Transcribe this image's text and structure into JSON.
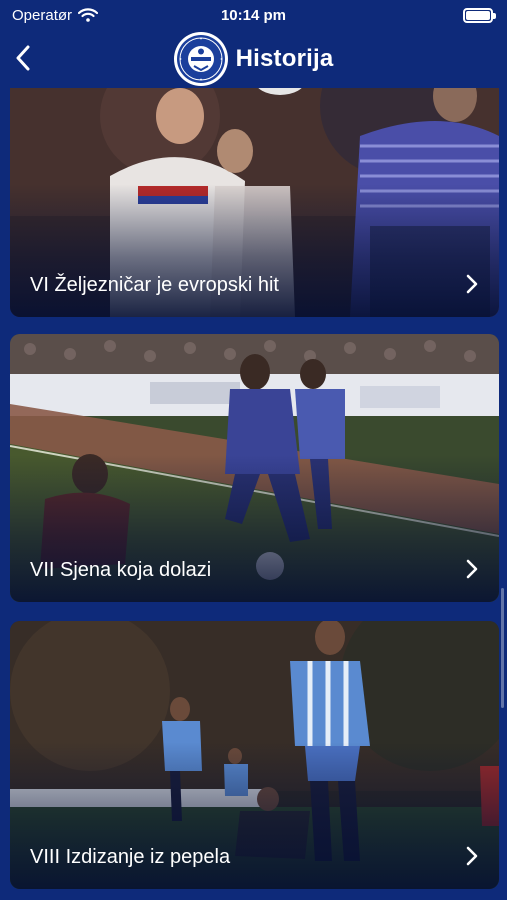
{
  "status_bar": {
    "carrier": "Operatør",
    "time": "10:14 pm"
  },
  "nav": {
    "title": "Historija",
    "logo_text": "FUDBALSKI KLUB ŽELJEZNIČAR"
  },
  "cards": [
    {
      "title": "VI Željezničar je evropski hit"
    },
    {
      "title": "VII Sjena koja dolazi"
    },
    {
      "title": "VIII Izdizanje iz pepela"
    }
  ],
  "colors": {
    "background": "#0e2a7a",
    "text": "#ffffff",
    "logo_blue": "#1b3f9c"
  },
  "icons": {
    "back": "chevron-left-icon",
    "row": "chevron-right-icon",
    "wifi": "wifi-icon",
    "battery": "battery-icon"
  }
}
